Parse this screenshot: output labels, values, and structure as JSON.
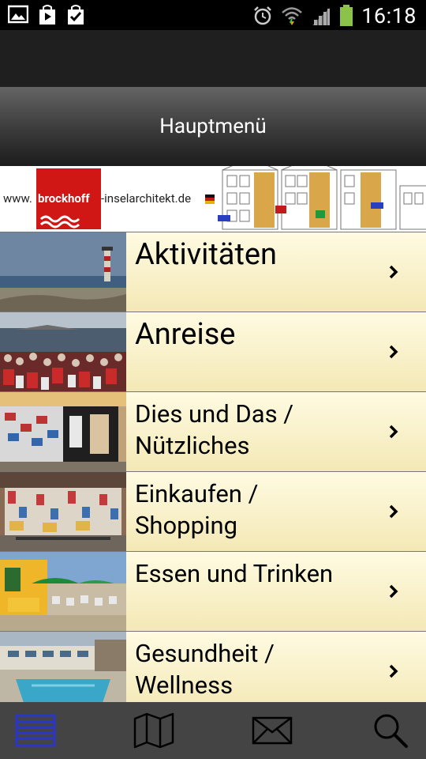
{
  "status_bar": {
    "time": "16:18",
    "icons": [
      "gallery-notification-icon",
      "play-store-icon",
      "checklist-icon",
      "alarm-icon",
      "wifi-icon",
      "signal-icon",
      "battery-icon"
    ]
  },
  "title": "Hauptmenü",
  "banner": {
    "prefix": "www.",
    "brand": "brockhoff",
    "domain": "-inselarchitekt.de"
  },
  "menu": [
    {
      "label": "Aktivitäten"
    },
    {
      "label": "Anreise"
    },
    {
      "label": "Dies und Das /\nNützliches"
    },
    {
      "label": "Einkaufen /\nShopping"
    },
    {
      "label": "Essen und Trinken"
    },
    {
      "label": "Gesundheit /\nWellness"
    }
  ],
  "bottom_nav": [
    "list-icon",
    "map-icon",
    "mail-icon",
    "search-icon"
  ],
  "colors": {
    "accent": "#2a36c8",
    "menu_bg": "#f6efc6"
  }
}
